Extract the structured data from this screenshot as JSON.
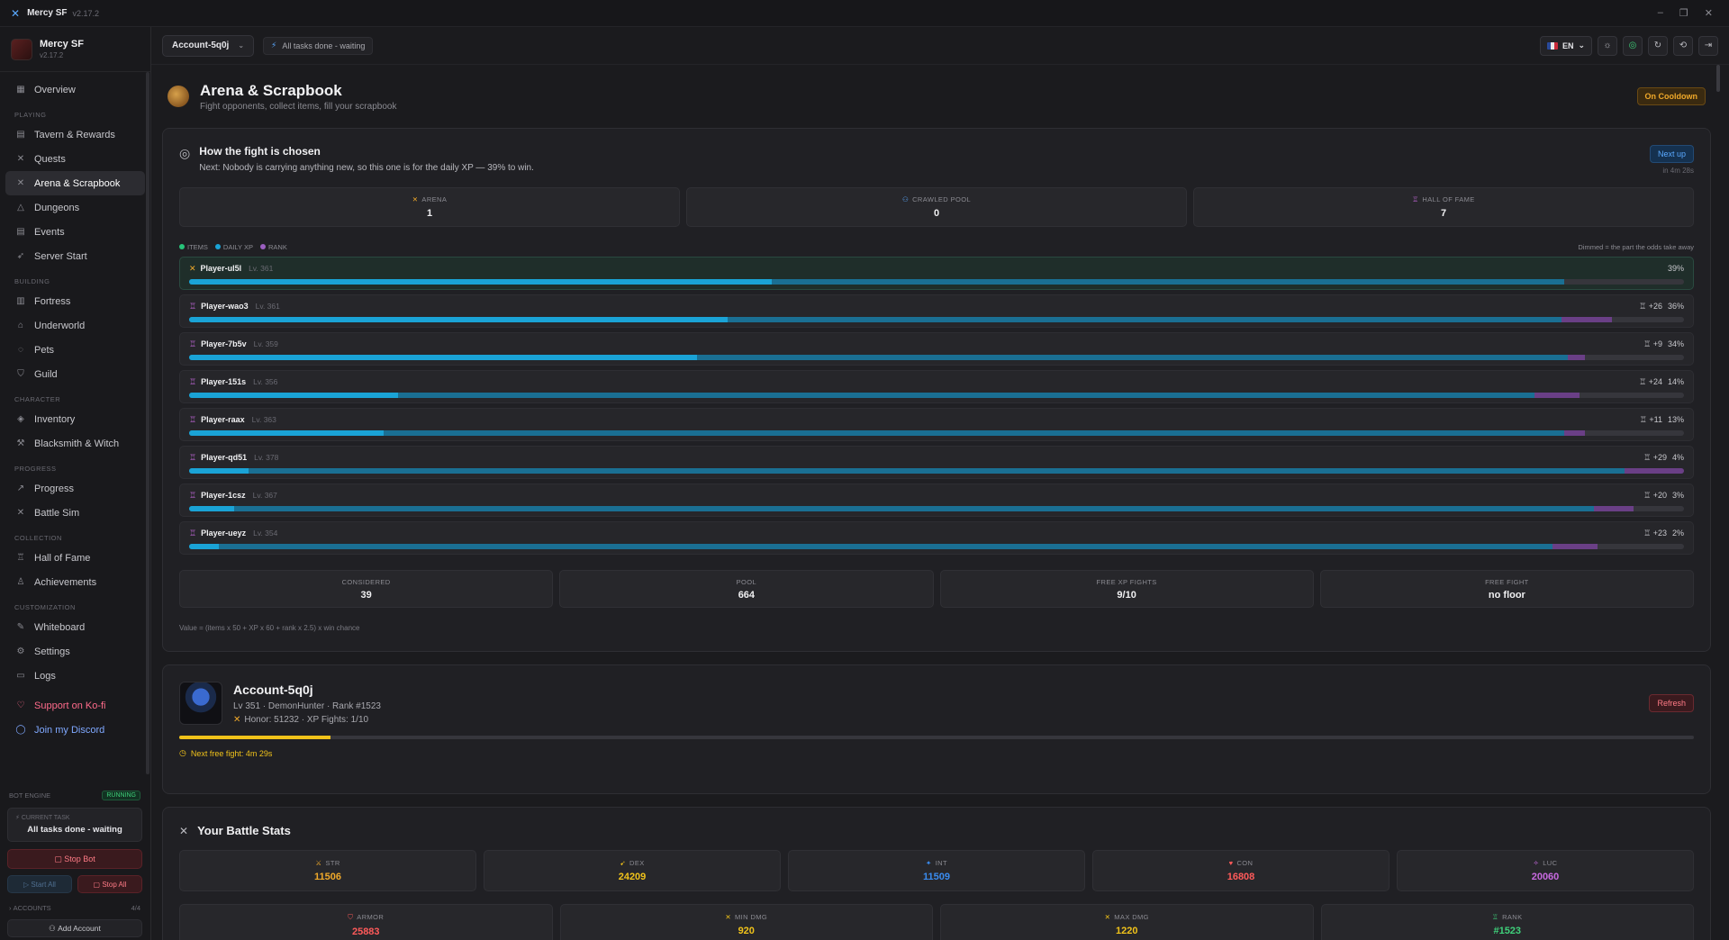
{
  "app": {
    "name": "Mercy SF",
    "version": "v2.17.2"
  },
  "brand": {
    "name": "Mercy SF",
    "version": "v2.17.2"
  },
  "sidebar": {
    "overview": "Overview",
    "sections": {
      "playing": "PLAYING",
      "building": "BUILDING",
      "character": "CHARACTER",
      "progress": "PROGRESS",
      "collection": "COLLECTION",
      "customization": "CUSTOMIZATION"
    },
    "items": {
      "tavern": "Tavern & Rewards",
      "quests": "Quests",
      "arena": "Arena & Scrapbook",
      "dungeons": "Dungeons",
      "events": "Events",
      "server_start": "Server Start",
      "fortress": "Fortress",
      "underworld": "Underworld",
      "pets": "Pets",
      "guild": "Guild",
      "inventory": "Inventory",
      "blacksmith": "Blacksmith & Witch",
      "progress": "Progress",
      "battle_sim": "Battle Sim",
      "hall_of_fame": "Hall of Fame",
      "achievements": "Achievements",
      "whiteboard": "Whiteboard",
      "settings": "Settings",
      "logs": "Logs",
      "kofi": "Support on Ko-fi",
      "discord": "Join my Discord"
    },
    "bot": {
      "engine_label": "BOT ENGINE",
      "status": "RUNNING",
      "current_task_label": "CURRENT TASK",
      "current_task": "All tasks done - waiting",
      "stop_bot": "Stop Bot",
      "start_all": "Start All",
      "stop_all": "Stop All",
      "accounts_label": "ACCOUNTS",
      "accounts_count": "4/4",
      "add_account": "Add Account"
    }
  },
  "topbar": {
    "account": "Account-5q0j",
    "status": "All tasks done - waiting",
    "lang": "EN"
  },
  "page": {
    "title": "Arena & Scrapbook",
    "subtitle": "Fight opponents, collect items, fill your scrapbook",
    "cooldown": "On Cooldown"
  },
  "fight": {
    "title": "How the fight is chosen",
    "desc": "Next: Nobody is carrying anything new, so this one is for the daily XP — 39% to win.",
    "next_up": "Next up",
    "next_time": "in 4m 28s",
    "sources": [
      {
        "label": "ARENA",
        "value": "1"
      },
      {
        "label": "CRAWLED POOL",
        "value": "0"
      },
      {
        "label": "HALL OF FAME",
        "value": "7"
      }
    ],
    "legend": {
      "items": "ITEMS",
      "xp": "DAILY XP",
      "rank": "RANK",
      "note": "Dimmed = the part the odds take away"
    },
    "colors": {
      "items": "#27c47a",
      "xp": "#1aa3d6",
      "rank": "#9b5fc0"
    },
    "opponents": [
      {
        "name": "Player-ul5l",
        "level": "Lv. 361",
        "rank": "",
        "chance": "39%",
        "win": 0.39,
        "xp_end": 0.92,
        "rank_end": 0.92
      },
      {
        "name": "Player-wao3",
        "level": "Lv. 361",
        "rank": "+26",
        "chance": "36%",
        "win": 0.36,
        "xp_end": 0.918,
        "rank_end": 0.952
      },
      {
        "name": "Player-7b5v",
        "level": "Lv. 359",
        "rank": "+9",
        "chance": "34%",
        "win": 0.34,
        "xp_end": 0.922,
        "rank_end": 0.934
      },
      {
        "name": "Player-151s",
        "level": "Lv. 356",
        "rank": "+24",
        "chance": "14%",
        "win": 0.14,
        "xp_end": 0.9,
        "rank_end": 0.93
      },
      {
        "name": "Player-raax",
        "level": "Lv. 363",
        "rank": "+11",
        "chance": "13%",
        "win": 0.13,
        "xp_end": 0.92,
        "rank_end": 0.934
      },
      {
        "name": "Player-qd51",
        "level": "Lv. 378",
        "rank": "+29",
        "chance": "4%",
        "win": 0.04,
        "xp_end": 0.96,
        "rank_end": 1.0
      },
      {
        "name": "Player-1csz",
        "level": "Lv. 367",
        "rank": "+20",
        "chance": "3%",
        "win": 0.03,
        "xp_end": 0.94,
        "rank_end": 0.966
      },
      {
        "name": "Player-ueyz",
        "level": "Lv. 354",
        "rank": "+23",
        "chance": "2%",
        "win": 0.02,
        "xp_end": 0.912,
        "rank_end": 0.942
      }
    ],
    "stats": [
      {
        "label": "CONSIDERED",
        "value": "39"
      },
      {
        "label": "POOL",
        "value": "664"
      },
      {
        "label": "FREE XP FIGHTS",
        "value": "9/10"
      },
      {
        "label": "FREE FIGHT",
        "value": "no floor"
      }
    ],
    "formula": "Value = (items x 50 + XP x 60 + rank x 2.5) x win chance"
  },
  "account": {
    "name": "Account-5q0j",
    "meta": "Lv 351 · DemonHunter · Rank #1523",
    "honor": "Honor: 51232 · XP Fights: 1/10",
    "refresh": "Refresh",
    "progress": 0.1,
    "free_fight": "Next free fight: 4m 29s"
  },
  "battle": {
    "title": "Your Battle Stats",
    "row1": [
      {
        "label": "STR",
        "value": "11506",
        "color": "#f0a92a"
      },
      {
        "label": "DEX",
        "value": "24209",
        "color": "#f0c21a"
      },
      {
        "label": "INT",
        "value": "11509",
        "color": "#3a8cf0"
      },
      {
        "label": "CON",
        "value": "16808",
        "color": "#ff5a5a"
      },
      {
        "label": "LUC",
        "value": "20060",
        "color": "#c86ae0"
      }
    ],
    "row2": [
      {
        "label": "ARMOR",
        "value": "25883",
        "color": "#ff5a5a"
      },
      {
        "label": "MIN DMG",
        "value": "920",
        "color": "#f0c21a"
      },
      {
        "label": "MAX DMG",
        "value": "1220",
        "color": "#f0c21a"
      },
      {
        "label": "RANK",
        "value": "#1523",
        "color": "#3fd07a"
      }
    ]
  }
}
